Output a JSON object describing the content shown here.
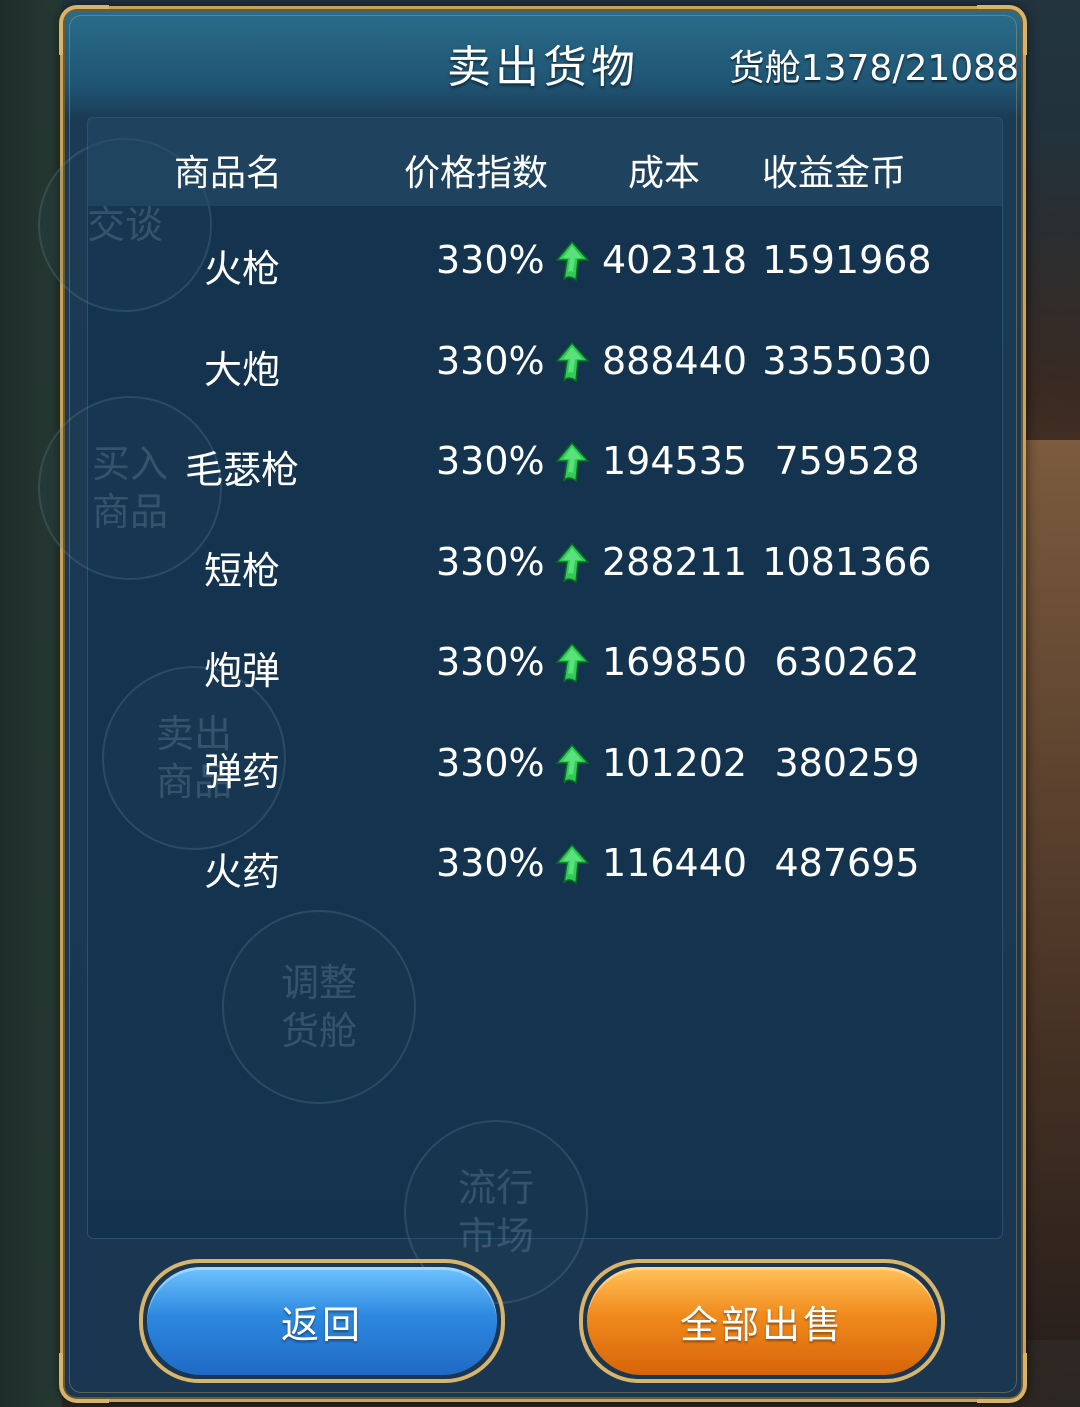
{
  "header": {
    "title": "卖出货物",
    "cargo_label": "货舱",
    "cargo_value": "1378/21088"
  },
  "table": {
    "columns": [
      "商品名",
      "价格指数",
      "成本",
      "收益金币"
    ],
    "rows": [
      {
        "name": "火枪",
        "price_index": "330%",
        "trend": "up",
        "cost": "402318",
        "gain": "1591968"
      },
      {
        "name": "大炮",
        "price_index": "330%",
        "trend": "up",
        "cost": "888440",
        "gain": "3355030"
      },
      {
        "name": "毛瑟枪",
        "price_index": "330%",
        "trend": "up",
        "cost": "194535",
        "gain": "759528"
      },
      {
        "name": "短枪",
        "price_index": "330%",
        "trend": "up",
        "cost": "288211",
        "gain": "1081366"
      },
      {
        "name": "炮弹",
        "price_index": "330%",
        "trend": "up",
        "cost": "169850",
        "gain": "630262"
      },
      {
        "name": "弹药",
        "price_index": "330%",
        "trend": "up",
        "cost": "101202",
        "gain": "380259"
      },
      {
        "name": "火药",
        "price_index": "330%",
        "trend": "up",
        "cost": "116440",
        "gain": "487695"
      }
    ]
  },
  "background_menu": [
    "交谈",
    "买入商品",
    "卖出商品",
    "调整货舱",
    "流行市场"
  ],
  "buttons": {
    "back": "返回",
    "sell_all": "全部出售"
  },
  "colors": {
    "panel_border": "#c8a35a",
    "back_button": "#2d89e0",
    "sell_button": "#f08a1c",
    "trend_up": "#2ecc55"
  }
}
